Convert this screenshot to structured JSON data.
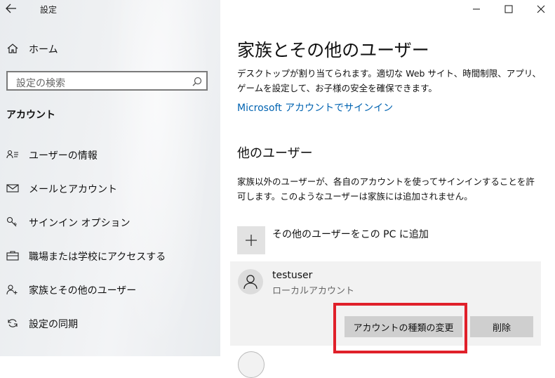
{
  "window": {
    "title": "設定",
    "back_icon": "arrow-left-icon",
    "controls": [
      "minimize-icon",
      "maximize-icon",
      "close-icon"
    ]
  },
  "sidebar": {
    "home": {
      "label": "ホーム",
      "icon": "home-icon"
    },
    "search": {
      "placeholder": "設定の検索",
      "icon": "search-icon"
    },
    "section_title": "アカウント",
    "items": [
      {
        "label": "ユーザーの情報",
        "icon": "person-card-icon"
      },
      {
        "label": "メールとアカウント",
        "icon": "mail-icon"
      },
      {
        "label": "サインイン オプション",
        "icon": "key-icon"
      },
      {
        "label": "職場または学校にアクセスする",
        "icon": "briefcase-icon"
      },
      {
        "label": "家族とその他のユーザー",
        "icon": "person-add-icon"
      },
      {
        "label": "設定の同期",
        "icon": "sync-icon"
      }
    ]
  },
  "main": {
    "title": "家族とその他のユーザー",
    "description": "デスクトップが割り当てられます。適切な Web サイト、時間制限、アプリ、ゲームを設定して、お子様の安全を確保できます。",
    "ms_link": "Microsoft アカウントでサインイン",
    "other_users": {
      "heading": "他のユーザー",
      "description": "家族以外のユーザーが、各自のアカウントを使ってサインインすることを許可します。このようなユーザーは家族には追加されません。",
      "add_label": "その他のユーザーをこの PC に追加",
      "users": [
        {
          "name": "testuser",
          "type": "ローカルアカウント"
        }
      ],
      "change_type_button": "アカウントの種類の変更",
      "delete_button": "削除"
    }
  },
  "colors": {
    "link": "#0063b1",
    "highlight": "#e0202a",
    "button": "#cfcfcf"
  }
}
